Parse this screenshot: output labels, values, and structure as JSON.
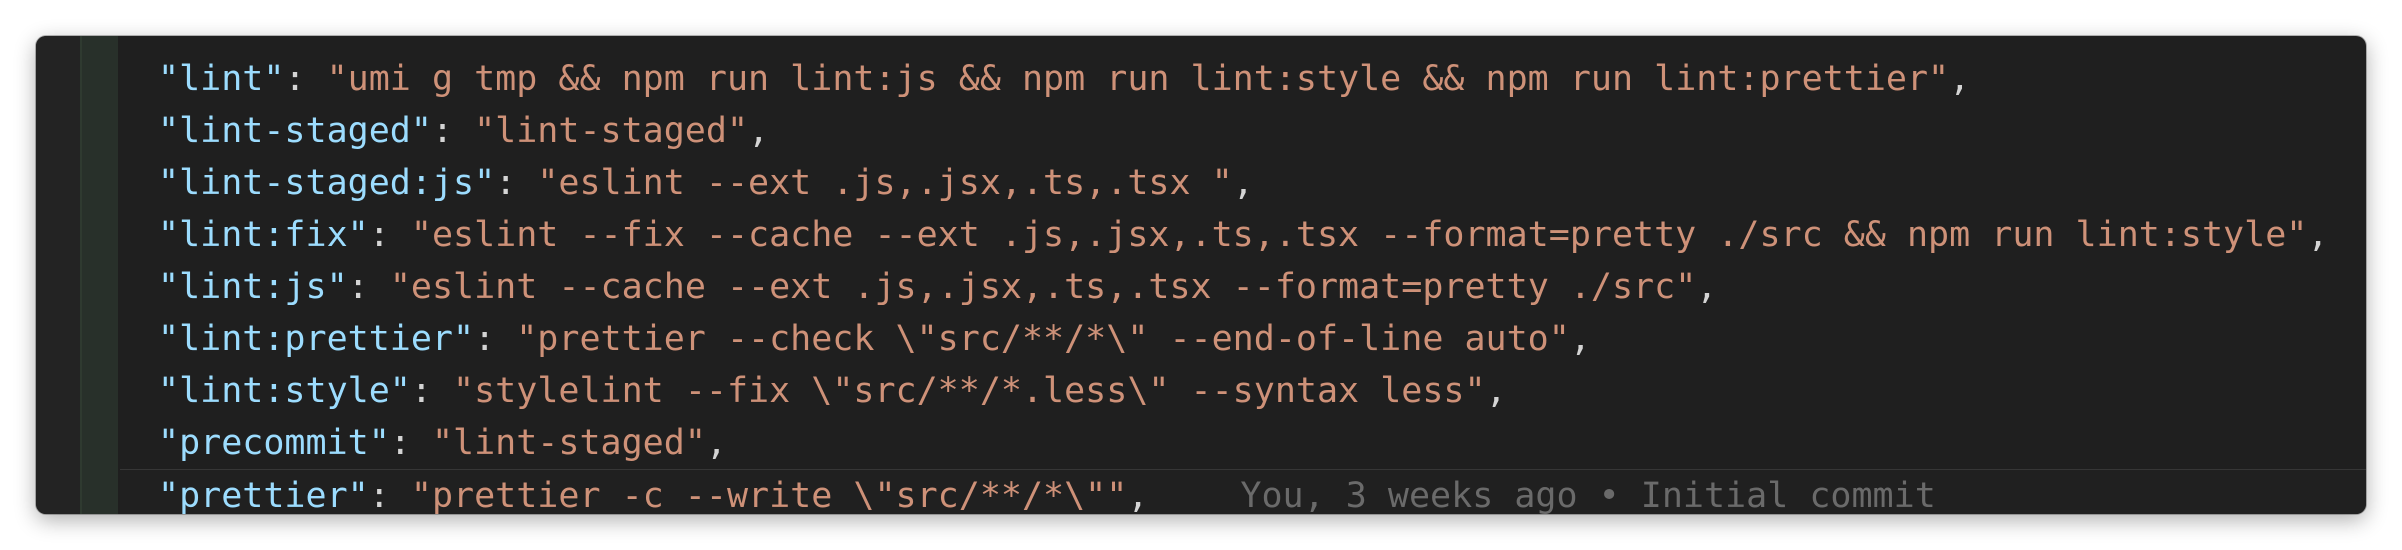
{
  "editor": {
    "lines": [
      {
        "key": "\"lint\"",
        "sep": ": ",
        "value": "\"umi g tmp && npm run lint:js && npm run lint:style && npm run lint:prettier\"",
        "end": ","
      },
      {
        "key": "\"lint-staged\"",
        "sep": ": ",
        "value": "\"lint-staged\"",
        "end": ","
      },
      {
        "key": "\"lint-staged:js\"",
        "sep": ": ",
        "value": "\"eslint --ext .js,.jsx,.ts,.tsx \"",
        "end": ","
      },
      {
        "key": "\"lint:fix\"",
        "sep": ": ",
        "value": "\"eslint --fix --cache --ext .js,.jsx,.ts,.tsx --format=pretty ./src && npm run lint:style\"",
        "end": ","
      },
      {
        "key": "\"lint:js\"",
        "sep": ": ",
        "value": "\"eslint --cache --ext .js,.jsx,.ts,.tsx --format=pretty ./src\"",
        "end": ","
      },
      {
        "key": "\"lint:prettier\"",
        "sep": ": ",
        "value": "\"prettier --check \\\"src/**/*\\\" --end-of-line auto\"",
        "end": ","
      },
      {
        "key": "\"lint:style\"",
        "sep": ": ",
        "value": "\"stylelint --fix \\\"src/**/*.less\\\" --syntax less\"",
        "end": ","
      },
      {
        "key": "\"precommit\"",
        "sep": ": ",
        "value": "\"lint-staged\"",
        "end": ","
      },
      {
        "key": "\"prettier\"",
        "sep": ": ",
        "value": "\"prettier -c --write \\\"src/**/*\\\"\"",
        "end": ",",
        "blame": "You, 3 weeks ago • Initial commit"
      }
    ]
  },
  "colors": {
    "background": "#1f1f1f",
    "key": "#9cdcfe",
    "string": "#ce9178",
    "blame": "#6a6a6a"
  }
}
